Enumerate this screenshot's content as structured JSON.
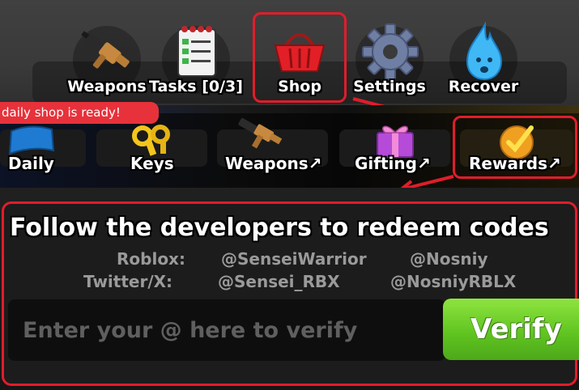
{
  "top_menu": {
    "items": [
      {
        "label": "Weapons",
        "icon": "gun-icon"
      },
      {
        "label": "Tasks [0/3]",
        "icon": "checklist-icon"
      },
      {
        "label": "Shop",
        "icon": "basket-icon"
      },
      {
        "label": "Settings",
        "icon": "gear-icon"
      },
      {
        "label": "Recover",
        "icon": "flame-icon"
      }
    ],
    "highlighted": "Shop"
  },
  "shop_tabs": {
    "notice": "daily shop is ready!",
    "items": [
      {
        "label": "Daily",
        "icon": "flag-icon"
      },
      {
        "label": "Keys",
        "icon": "keys-icon"
      },
      {
        "label": "Weapons↗",
        "icon": "gun-icon"
      },
      {
        "label": "Gifting↗",
        "icon": "gift-icon"
      },
      {
        "label": "Rewards↗",
        "icon": "checkmark-badge-icon"
      }
    ],
    "highlighted": "Rewards↗"
  },
  "codes_panel": {
    "title": "Follow the developers to redeem codes",
    "roblox_label": "Roblox:",
    "roblox_handles": [
      "@SenseiWarrior",
      "@Nosniy"
    ],
    "twitter_label": "Twitter/X:",
    "twitter_handles": [
      "@Sensei_RBX",
      "@NosniyRBLX"
    ],
    "input_placeholder": "Enter your @ here to verify",
    "input_value": "",
    "verify_label": "Verify"
  },
  "colors": {
    "highlight": "#e01d2b",
    "verify_green": "#5ec21f",
    "notice_red": "#e7323b"
  }
}
